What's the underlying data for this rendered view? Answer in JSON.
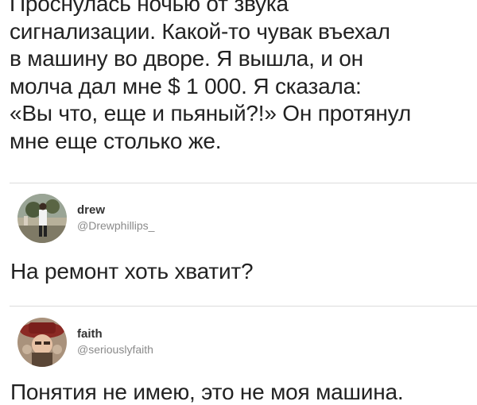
{
  "post": {
    "lines": [
      "Проснулась ночью от звука",
      "сигнализации. Какой-то чувак въехал",
      "в машину во дворе. Я вышла, и он",
      "молча дал мне $ 1 000. Я сказала:",
      "«Вы что, еще и пьяный?!» Он протянул",
      "мне еще столько же."
    ]
  },
  "replies": [
    {
      "display_name": "drew",
      "username": "@Drewphillips_",
      "text": "На ремонт хоть хватит?"
    },
    {
      "display_name": "faith",
      "username": "@seriouslyfaith",
      "text": "Понятия не имею, это не моя машина."
    }
  ]
}
